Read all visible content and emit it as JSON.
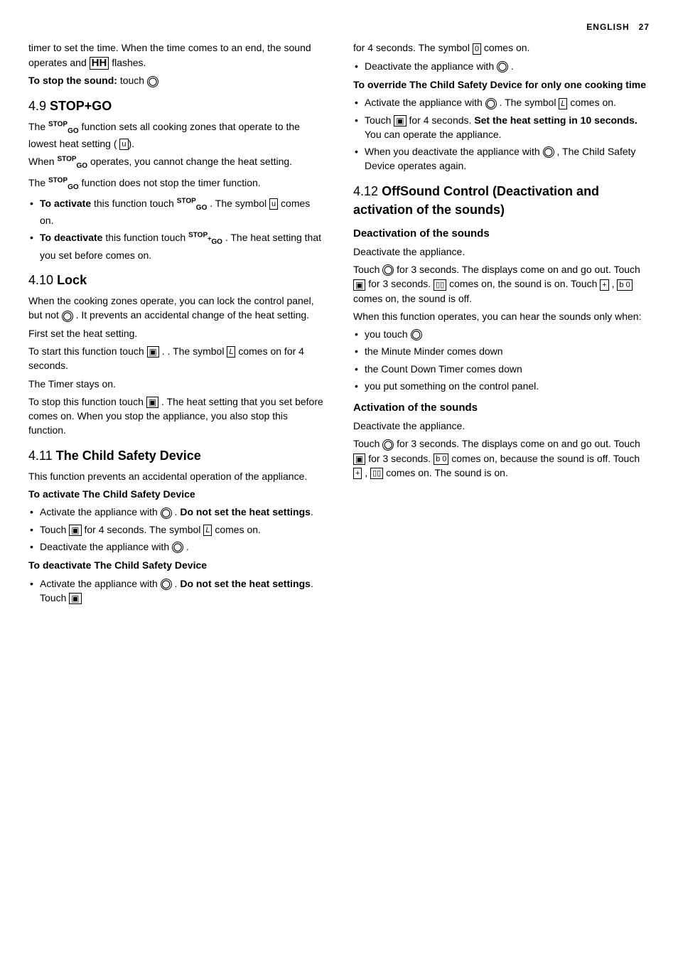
{
  "header": {
    "lang": "ENGLISH",
    "page": "27"
  },
  "left_col": {
    "intro_text": "timer to set the time. When the time comes to an end, the sound operates and",
    "flashes_text": "flashes.",
    "stop_sound": "To stop the sound:",
    "stop_sound_verb": "touch",
    "section_49_num": "4.9",
    "section_49_title": "STOP+GO",
    "s49_p1": "The",
    "s49_p1b": "function sets all cooking zones that operate to the lowest heat setting (",
    "s49_p2": "When",
    "s49_p2b": "operates, you cannot change the heat setting.",
    "s49_p3": "The",
    "s49_p3b": "function does not stop the timer function.",
    "s49_b1_pre": "To activate",
    "s49_b1_mid": "this function touch",
    "s49_b1_post": ". The symbol",
    "s49_b1_end": "comes on.",
    "s49_b2_pre": "To deactivate",
    "s49_b2_mid": "this function touch",
    "s49_b2_post": ". The heat setting that you set before comes on.",
    "section_410_num": "4.10",
    "section_410_title": "Lock",
    "s410_p1": "When the cooking zones operate, you can lock the control panel, but not",
    "s410_p1b": ". It prevents an accidental change of the heat setting.",
    "s410_p2": "First set the heat setting.",
    "s410_p3": "To start this function touch",
    "s410_p3b": ". The symbol",
    "s410_p3c": "comes on for 4 seconds.",
    "s410_p4": "The Timer stays on.",
    "s410_p5": "To stop this function touch",
    "s410_p5b": ". The heat setting that you set before comes on. When you stop the appliance, you also stop this function.",
    "section_411_num": "4.11",
    "section_411_title": "The Child Safety Device",
    "s411_p1": "This function prevents an accidental operation of the appliance.",
    "s411_activate_head": "To activate The Child Safety Device",
    "s411_b1_pre": "Activate the appliance with",
    "s411_b1_mid": ". ",
    "s411_b1_bold": "Do not set the heat settings",
    "s411_b1_end": ".",
    "s411_b2_pre": "Touch",
    "s411_b2_mid": "for 4 seconds. The symbol",
    "s411_b2_end": "comes on.",
    "s411_b3": "Deactivate the appliance with",
    "s411_deactivate_head": "To deactivate The Child Safety Device",
    "s411_d1_pre": "Activate the appliance with",
    "s411_d1_mid": ". ",
    "s411_d1_bold": "Do not set the heat settings",
    "s411_d1_end": ". Touch"
  },
  "right_col": {
    "s411_cont": "for 4 seconds. The symbol",
    "s411_cont2": "comes on.",
    "s411_deact_b2": "Deactivate the appliance with",
    "s411_override_head": "To override The Child Safety Device for only one cooking time",
    "s411_o1_pre": "Activate the appliance with",
    "s411_o1_mid": ". The symbol",
    "s411_o1_end": "comes on.",
    "s411_o2_pre": "Touch",
    "s411_o2_mid": "for 4 seconds.",
    "s411_o2_bold": "Set the heat setting in 10 seconds.",
    "s411_o2_end": "You can operate the appliance.",
    "s411_o3_pre": "When you deactivate the appliance with",
    "s411_o3_mid": ", The Child Safety Device operates again.",
    "section_412_num": "4.12",
    "section_412_title": "OffSound Control (Deactivation and activation of the sounds)",
    "deact_sounds_title": "Deactivation of the sounds",
    "deact_p1": "Deactivate the appliance.",
    "deact_p2": "Touch",
    "deact_p2b": "for 3 seconds. The displays come on and go out. Touch",
    "deact_p2c": "for 3 seconds.",
    "deact_p3_pre": "comes on, the sound is on. Touch",
    "deact_p3_mid": ",",
    "deact_p3_end": "comes on, the sound is off.",
    "deact_p4": "When this function operates, you can hear the sounds only when:",
    "deact_b1": "you touch",
    "deact_b2": "the Minute Minder comes down",
    "deact_b3": "the Count Down Timer comes down",
    "deact_b4": "you put something on the control panel.",
    "act_sounds_title": "Activation of the sounds",
    "act_p1": "Deactivate the appliance.",
    "act_p2": "Touch",
    "act_p2b": "for 3 seconds. The displays come on and go out. Touch",
    "act_p2c": "for 3 seconds.",
    "act_p3_pre": "comes on, because the sound is off. Touch",
    "act_p3_mid": ",",
    "act_p3_end": "comes on. The sound is on."
  }
}
